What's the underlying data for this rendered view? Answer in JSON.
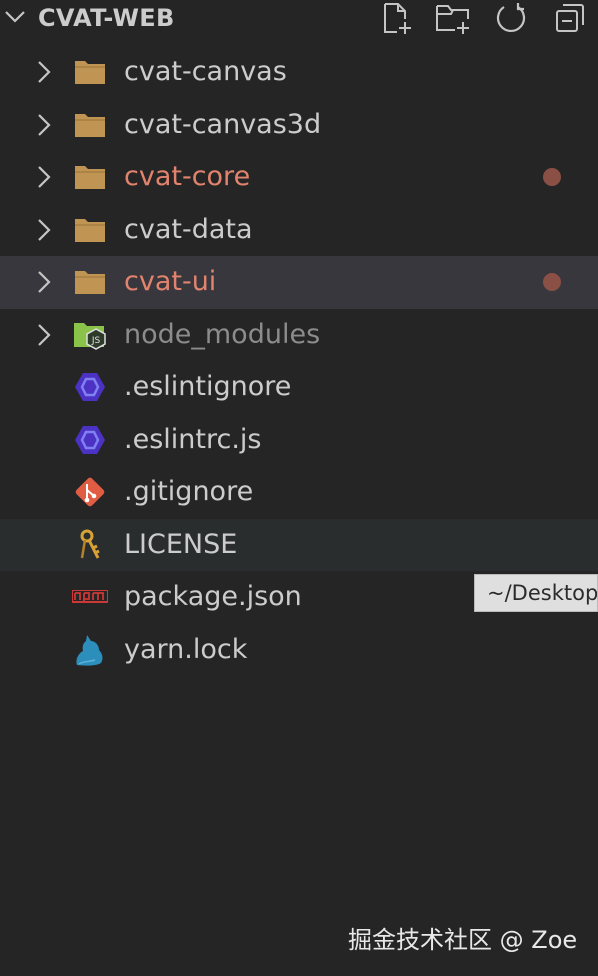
{
  "explorer": {
    "title": "CVAT-WEB",
    "collapse_icon": "chevron-down-icon",
    "actions": [
      {
        "name": "new-file-button",
        "icon": "new-file-icon"
      },
      {
        "name": "new-folder-button",
        "icon": "new-folder-icon"
      },
      {
        "name": "refresh-button",
        "icon": "refresh-icon"
      },
      {
        "name": "collapse-all-button",
        "icon": "collapse-all-icon"
      }
    ]
  },
  "tree": {
    "items": [
      {
        "label": "cvat-canvas",
        "type": "folder",
        "icon": "folder-icon",
        "modified": false
      },
      {
        "label": "cvat-canvas3d",
        "type": "folder",
        "icon": "folder-icon",
        "modified": false
      },
      {
        "label": "cvat-core",
        "type": "folder",
        "icon": "folder-icon",
        "modified": true
      },
      {
        "label": "cvat-data",
        "type": "folder",
        "icon": "folder-icon",
        "modified": false
      },
      {
        "label": "cvat-ui",
        "type": "folder",
        "icon": "folder-icon",
        "modified": true,
        "selected": true
      },
      {
        "label": "node_modules",
        "type": "folder",
        "icon": "nodejs-folder-icon",
        "ignored": true
      },
      {
        "label": ".eslintignore",
        "type": "file",
        "icon": "eslint-icon"
      },
      {
        "label": ".eslintrc.js",
        "type": "file",
        "icon": "eslint-icon"
      },
      {
        "label": ".gitignore",
        "type": "file",
        "icon": "git-icon"
      },
      {
        "label": "LICENSE",
        "type": "file",
        "icon": "license-key-icon",
        "hovered": true
      },
      {
        "label": "package.json",
        "type": "file",
        "icon": "npm-icon"
      },
      {
        "label": "yarn.lock",
        "type": "file",
        "icon": "yarn-icon"
      }
    ]
  },
  "tooltip": {
    "text": "~/Desktop/"
  },
  "watermark": {
    "text": "掘金技术社区 @ Zoe"
  },
  "colors": {
    "background": "#252526",
    "selected_row": "#37373d",
    "hover_row": "#2a2d2e",
    "modified_text": "#e2836e",
    "modified_dot": "#8a4f45",
    "folder": "#c09553",
    "eslint": "#4b32c3",
    "git": "#e05d44"
  }
}
